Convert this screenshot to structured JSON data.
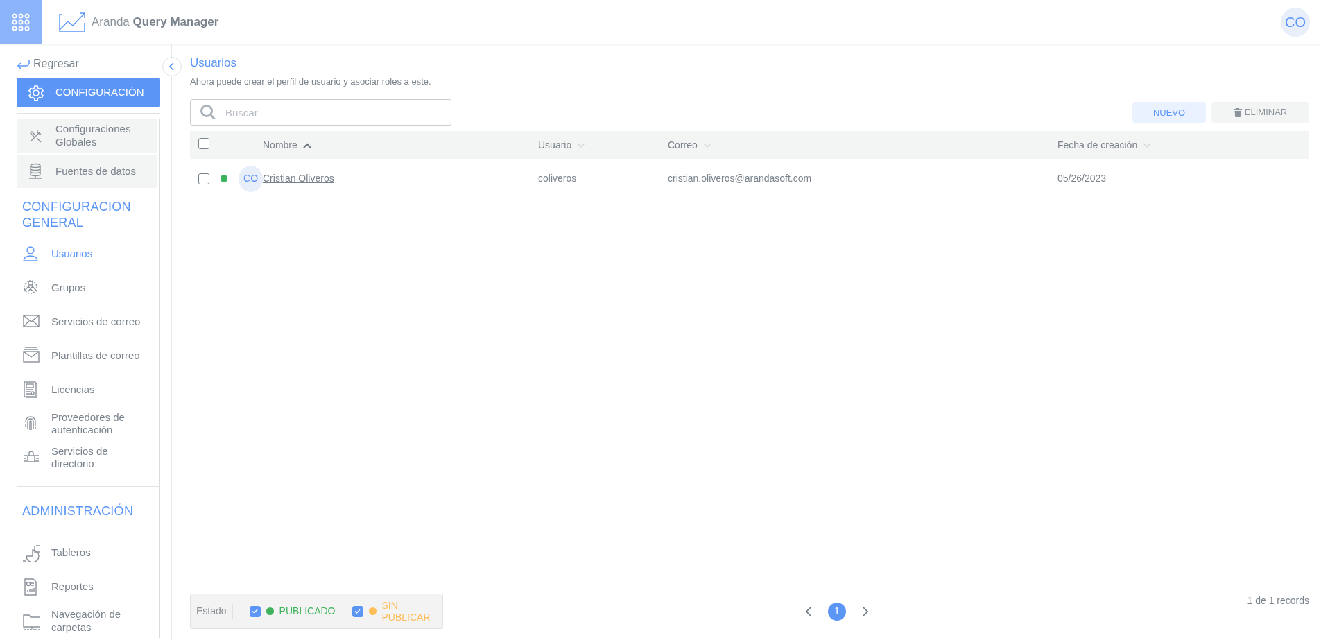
{
  "header": {
    "app_title": "Aranda **Query Manager**",
    "avatar": "CO"
  },
  "sidebar": {
    "back_link": "Regresar",
    "module_button": "CONFIGURACIÓN",
    "sub_items": [
      {
        "label": "Configuraciones Globales"
      },
      {
        "label": "Fuentes de datos"
      }
    ],
    "sections": [
      {
        "title": "CONFIGURACION GENERAL",
        "items": [
          {
            "label": "Usuarios",
            "selected": true
          },
          {
            "label": "Grupos",
            "selected": false
          },
          {
            "label": "Servicios de correo",
            "selected": false
          },
          {
            "label": "Plantillas de correo",
            "selected": false
          },
          {
            "label": "Licencias",
            "selected": false
          },
          {
            "label": "Proveedores de autenticación",
            "selected": false
          },
          {
            "label": "Servicios de directorio",
            "selected": false
          }
        ]
      },
      {
        "title": "ADMINISTRACIÓN",
        "items": [
          {
            "label": "Tableros",
            "selected": false
          },
          {
            "label": "Reportes",
            "selected": false
          },
          {
            "label": "Navegación de carpetas",
            "selected": false
          }
        ]
      }
    ]
  },
  "page": {
    "title": "Usuarios",
    "subtitle": "Ahora puede crear el perfil de usuario y asociar roles a este.",
    "search": {
      "placeholder": "Buscar"
    },
    "buttons": [
      {
        "label": "NUEVO",
        "kind": "primary"
      },
      {
        "label": "ELIMINAR",
        "kind": "delete"
      }
    ]
  },
  "table": {
    "select_all_checked": false,
    "columns": [
      {
        "label": "Nombre",
        "sorted": true
      },
      {
        "label": "Usuario",
        "sorted": false
      },
      {
        "label": "Correo",
        "sorted": false
      },
      {
        "label": "Fecha de creación",
        "sorted": false
      }
    ],
    "rows": [
      {
        "checked": false,
        "color": "#3cb35a",
        "avatar": "CO",
        "cells": [
          "Cristian Oliveros",
          "coliveros",
          "cristian.oliveros@arandasoft.com",
          "05/26/2023"
        ]
      }
    ]
  },
  "footer": {
    "filter_label": "Estado",
    "filters": [
      {
        "label": "PUBLICADO",
        "checked": true,
        "color": "#3cb35a"
      },
      {
        "label": "SIN PUBLICAR",
        "checked": true,
        "color": "#ffbd5a"
      }
    ],
    "pages": [
      {
        "label": "1",
        "selected": true
      }
    ],
    "records": "1 de 1 records"
  }
}
